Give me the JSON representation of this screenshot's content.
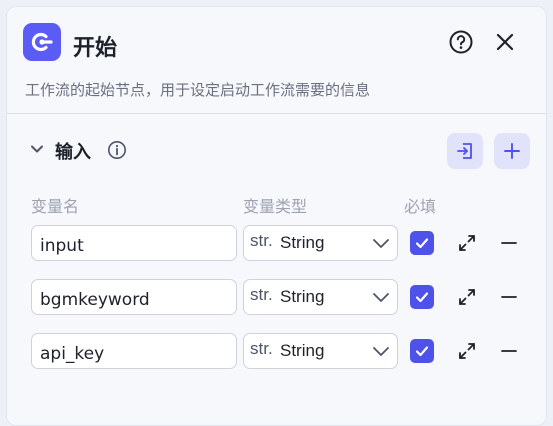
{
  "header": {
    "title": "开始",
    "description": "工作流的起始节点，用于设定启动工作流需要的信息"
  },
  "inputs_section": {
    "title": "输入",
    "columns": {
      "name": "变量名",
      "type": "变量类型",
      "required": "必填"
    },
    "rows": [
      {
        "name": "input",
        "type_icon": "str.",
        "type": "String",
        "required": true
      },
      {
        "name": "bgmkeyword",
        "type_icon": "str.",
        "type": "String",
        "required": true
      },
      {
        "name": "api_key",
        "type_icon": "str.",
        "type": "String",
        "required": true
      }
    ]
  },
  "icons": {
    "logo": "workflow-start-icon",
    "help": "help-circle-icon",
    "close": "close-icon",
    "collapse": "chevron-down-icon",
    "info": "info-icon",
    "import": "import-icon",
    "add": "plus-icon",
    "expand": "expand-icon",
    "remove": "minus-icon"
  },
  "colors": {
    "accent": "#5b5cf6",
    "checkbox": "#4f52e8",
    "button_bg": "#e1e3fb"
  }
}
